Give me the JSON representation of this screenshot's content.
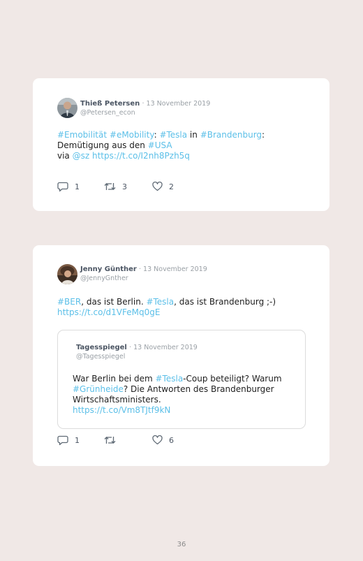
{
  "tweets": [
    {
      "author": {
        "name": "Thieß Petersen",
        "date": "· 13 November 2019",
        "handle": "@Petersen_econ"
      },
      "text": {
        "l1_h1": "#Emobilität",
        "l1_h2": "#eMobility",
        "l1_colon1": ": ",
        "l1_h3": "#Tesla",
        "l1_in": " in ",
        "l1_h4": "#Brandenburg",
        "l1_colon2": ":",
        "l2_a": "Demütigung aus den ",
        "l2_h": "#USA",
        "l3_via": "via ",
        "l3_mention": "@sz",
        "l3_url": "https://t.co/I2nh8Pzh5q"
      },
      "actions": {
        "replies": "1",
        "retweets": "3",
        "likes": "2"
      }
    },
    {
      "author": {
        "name": "Jenny Günther",
        "date": "· 13 November 2019",
        "handle": "@JennyGnther"
      },
      "text": {
        "l1_h1": "#BER",
        "l1_a": ", das ist Berlin. ",
        "l1_h2": "#Tesla",
        "l1_b": ", das ist Brandenburg ;-)",
        "l2_url": "https://t.co/d1VFeMq0gE"
      },
      "quote": {
        "name": "Tagesspiegel",
        "date": "· 13 November 2019",
        "handle": "@Tagesspiegel",
        "l1_a": "War Berlin bei dem ",
        "l1_h": "#Tesla",
        "l1_b": "-Coup beteiligt? Warum",
        "l2_h": "#Grünheide",
        "l2_a": "? Die Antworten des Brandenburger",
        "l3": "Wirtschaftsministers.",
        "l4_url": "https://t.co/Vm8TJtf9kN"
      },
      "actions": {
        "replies": "1",
        "retweets": "",
        "likes": "6"
      }
    }
  ],
  "page_number": "36",
  "colors": {
    "background": "#f0e8e6",
    "card": "#ffffff",
    "link": "#5bbfe8",
    "name": "#4b5563",
    "meta": "#9aa0a6"
  },
  "icons": [
    "reply-icon",
    "retweet-icon",
    "like-icon"
  ]
}
